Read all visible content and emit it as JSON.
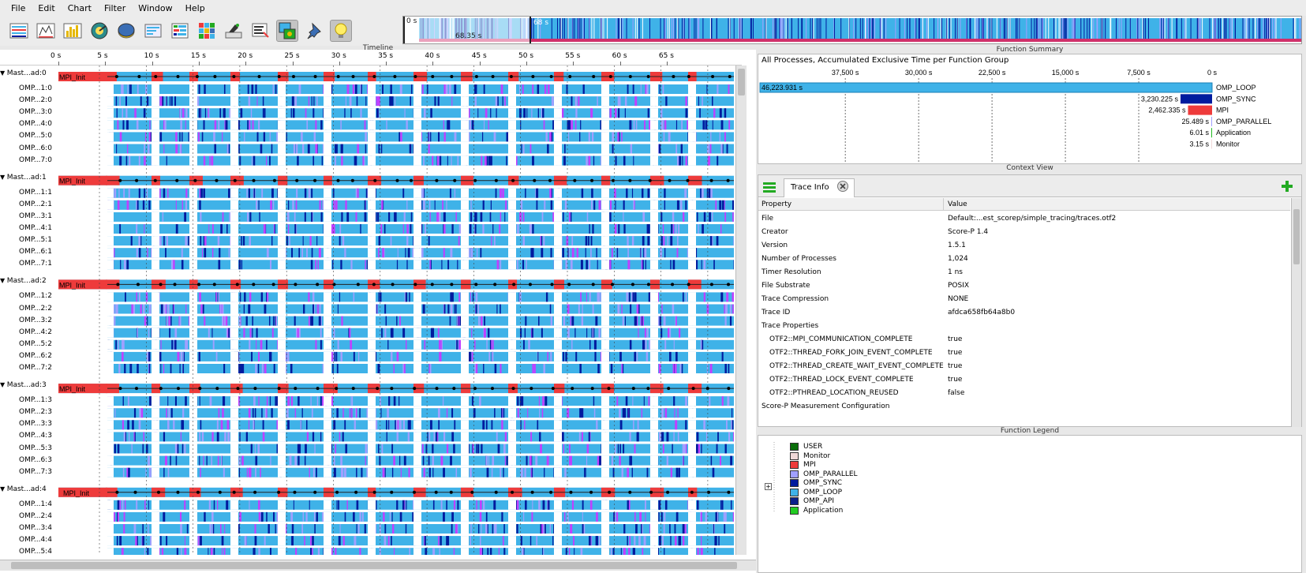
{
  "menu": [
    "File",
    "Edit",
    "Chart",
    "Filter",
    "Window",
    "Help"
  ],
  "toolbar": {
    "icons": [
      "master-timeline-icon",
      "process-timeline-icon",
      "counter-timeline-icon",
      "communication-matrix-icon",
      "call-tree-icon",
      "message-summary-icon",
      "io-summary-icon",
      "process-summary-icon",
      "open-otf2-icon",
      "marker-view-icon",
      "filter-icon",
      "pin-icon",
      "lightbulb-icon"
    ]
  },
  "overview": {
    "start_label": "0 s",
    "mid_label": "68.35 s",
    "end_label": "68 s"
  },
  "timeline": {
    "title": "Timeline",
    "axis_ticks": [
      "0 s",
      "5 s",
      "10 s",
      "15 s",
      "20 s",
      "25 s",
      "30 s",
      "35 s",
      "40 s",
      "45 s",
      "50 s",
      "55 s",
      "60 s",
      "65 s"
    ],
    "process_groups": [
      {
        "label": "Mast...ad:0",
        "threads": [
          "OMP...1:0",
          "OMP...2:0",
          "OMP...3:0",
          "OMP...4:0",
          "OMP...5:0",
          "OMP...6:0",
          "OMP...7:0"
        ]
      },
      {
        "label": "Mast...ad:1",
        "threads": [
          "OMP...1:1",
          "OMP...2:1",
          "OMP...3:1",
          "OMP...4:1",
          "OMP...5:1",
          "OMP...6:1",
          "OMP...7:1"
        ]
      },
      {
        "label": "Mast...ad:2",
        "threads": [
          "OMP...1:2",
          "OMP...2:2",
          "OMP...3:2",
          "OMP...4:2",
          "OMP...5:2",
          "OMP...6:2",
          "OMP...7:2"
        ]
      },
      {
        "label": "Mast...ad:3",
        "threads": [
          "OMP...1:3",
          "OMP...2:3",
          "OMP...3:3",
          "OMP...4:3",
          "OMP...5:3",
          "OMP...6:3",
          "OMP...7:3"
        ]
      },
      {
        "label": "Mast...ad:4",
        "threads": [
          "OMP...1:4",
          "OMP...2:4",
          "OMP...3:4",
          "OMP...4:4",
          "OMP...5:4"
        ]
      }
    ],
    "init_label": "MPI_Init"
  },
  "function_summary": {
    "panel_title": "Function Summary",
    "title": "All Processes, Accumulated Exclusive Time per Function Group",
    "axis_ticks": [
      "37,500 s",
      "30,000 s",
      "22,500 s",
      "15,000 s",
      "7,500 s",
      "0 s"
    ],
    "bars": [
      {
        "name": "OMP_LOOP",
        "value_label": "46,223.931 s",
        "value": 46223.931,
        "color": "#3fb2e8"
      },
      {
        "name": "OMP_SYNC",
        "value_label": "3,230.225 s",
        "value": 3230.225,
        "color": "#001b9e"
      },
      {
        "name": "MPI",
        "value_label": "2,462.335 s",
        "value": 2462.335,
        "color": "#ee3b3b"
      },
      {
        "name": "OMP_PARALLEL",
        "value_label": "25.489 s",
        "value": 25.489,
        "color": "#a0a0ff"
      },
      {
        "name": "Application",
        "value_label": "6.01 s",
        "value": 6.01,
        "color": "#22bb22"
      },
      {
        "name": "Monitor",
        "value_label": "3.15 s",
        "value": 3.15,
        "color": "#f0d8d8"
      }
    ]
  },
  "context_view": {
    "panel_title": "Context View",
    "tab_label": "Trace Info",
    "columns": [
      "Property",
      "Value"
    ],
    "rows": [
      {
        "k": "File",
        "v": "Default:...est_scorep/simple_tracing/traces.otf2",
        "indent": false
      },
      {
        "k": "Creator",
        "v": "Score-P 1.4",
        "indent": false
      },
      {
        "k": "Version",
        "v": "1.5.1",
        "indent": false
      },
      {
        "k": "Number of Processes",
        "v": "1,024",
        "indent": false
      },
      {
        "k": "Timer Resolution",
        "v": "1 ns",
        "indent": false
      },
      {
        "k": "File Substrate",
        "v": "POSIX",
        "indent": false
      },
      {
        "k": "Trace Compression",
        "v": "NONE",
        "indent": false
      },
      {
        "k": "Trace ID",
        "v": "afdca658fb64a8b0",
        "indent": false
      },
      {
        "k": "Trace Properties",
        "v": "",
        "indent": false
      },
      {
        "k": "OTF2::MPI_COMMUNICATION_COMPLETE",
        "v": "true",
        "indent": true
      },
      {
        "k": "OTF2::THREAD_FORK_JOIN_EVENT_COMPLETE",
        "v": "true",
        "indent": true
      },
      {
        "k": "OTF2::THREAD_CREATE_WAIT_EVENT_COMPLETE",
        "v": "true",
        "indent": true
      },
      {
        "k": "OTF2::THREAD_LOCK_EVENT_COMPLETE",
        "v": "true",
        "indent": true
      },
      {
        "k": "OTF2::PTHREAD_LOCATION_REUSED",
        "v": "false",
        "indent": true
      },
      {
        "k": "Score-P Measurement Configuration",
        "v": "",
        "indent": false
      }
    ]
  },
  "function_legend": {
    "panel_title": "Function Legend",
    "items": [
      {
        "name": "USER",
        "color": "#0a6e0a"
      },
      {
        "name": "Monitor",
        "color": "#f0d8d8"
      },
      {
        "name": "MPI",
        "color": "#ee3b3b"
      },
      {
        "name": "OMP_PARALLEL",
        "color": "#a0a0ff"
      },
      {
        "name": "OMP_SYNC",
        "color": "#001b9e"
      },
      {
        "name": "OMP_LOOP",
        "color": "#3fb2e8"
      },
      {
        "name": "OMP_API",
        "color": "#0a1f8a"
      },
      {
        "name": "Application",
        "color": "#22cc22"
      }
    ]
  }
}
